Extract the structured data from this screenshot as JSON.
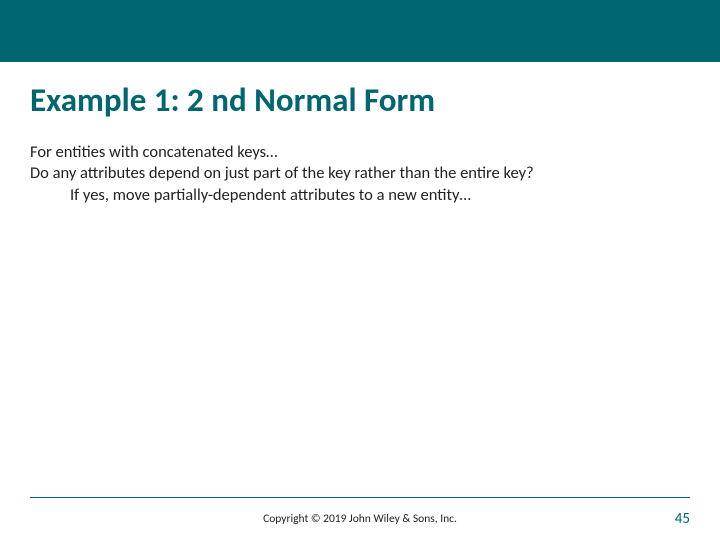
{
  "slide": {
    "title": "Example 1: 2 nd Normal Form",
    "line1": "For entities with concatenated keys…",
    "line2": "Do any attributes depend on just part of the key rather than the entire key?",
    "line3": "If yes, move partially-dependent attributes to a new entity…"
  },
  "footer": {
    "copyright": "Copyright © 2019 John Wiley & Sons, Inc.",
    "page_number": "45"
  }
}
